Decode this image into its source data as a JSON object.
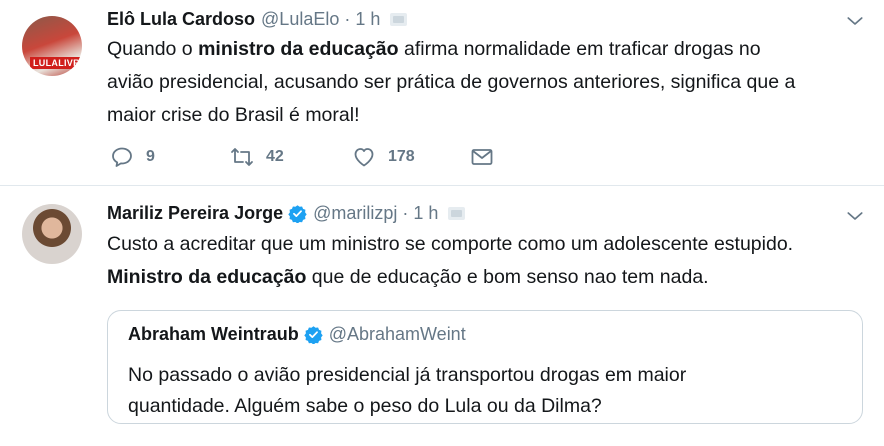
{
  "tweets": [
    {
      "name": "Elô Lula Cardoso",
      "handle": "@LulaElo",
      "separator": "·",
      "time": "1 h",
      "avatar_badge": "LULALIVRE",
      "text_lines": [
        {
          "before": "Quando o ",
          "bold": "ministro da educação",
          "after": " afirma normalidade em traficar drogas no"
        },
        {
          "before": "avião presidencial, acusando ser prática de governos anteriores, significa que a"
        },
        {
          "before": "maior crise do Brasil é moral!"
        }
      ],
      "actions": {
        "reply_count": "9",
        "retweet_count": "42",
        "like_count": "178"
      }
    },
    {
      "name": "Mariliz Pereira Jorge",
      "verified": true,
      "handle": "@marilizpj",
      "separator": "·",
      "time": "1 h",
      "text_lines": [
        {
          "before": "Custo a acreditar que um ministro se comporte como um adolescente estupido."
        },
        {
          "bold": "Ministro da educação",
          "after": " que de educação e bom senso nao tem nada."
        }
      ],
      "quote": {
        "name": "Abraham Weintraub",
        "verified": true,
        "handle": "@AbrahamWeint",
        "text_lines": [
          "No passado o avião presidencial já transportou drogas em maior",
          "quantidade. Alguém sabe o peso do Lula ou da Dilma?"
        ]
      }
    }
  ],
  "icons": {
    "reply": "reply-icon",
    "retweet": "retweet-icon",
    "like": "heart-icon",
    "dm": "envelope-icon",
    "menu": "chevron-down-icon",
    "verified": "verified-badge-icon"
  },
  "colors": {
    "text": "#14171a",
    "secondary": "#657786",
    "verified": "#1da1f2",
    "border": "#e1e8ed"
  }
}
